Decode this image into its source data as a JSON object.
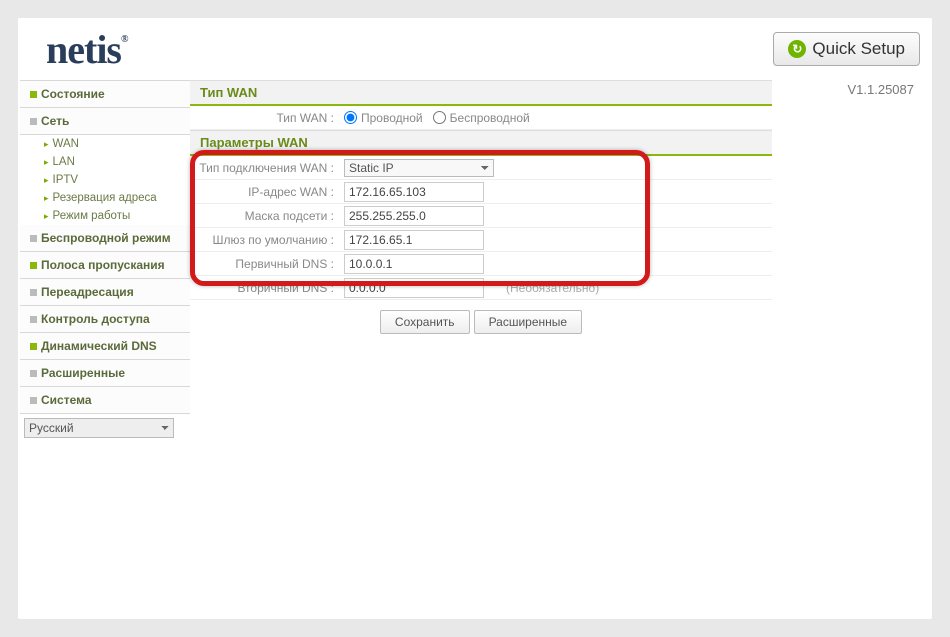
{
  "brand": "netis",
  "quick_setup": "Quick Setup",
  "version": "V1.1.25087",
  "language": {
    "selected": "Русский"
  },
  "sidebar": {
    "items": [
      {
        "label": "Состояние",
        "color": "green"
      },
      {
        "label": "Сеть",
        "color": "gray",
        "sub": [
          {
            "label": "WAN"
          },
          {
            "label": "LAN"
          },
          {
            "label": "IPTV"
          },
          {
            "label": "Резервация адреса"
          },
          {
            "label": "Режим работы"
          }
        ]
      },
      {
        "label": "Беспроводной режим",
        "color": "gray"
      },
      {
        "label": "Полоса пропускания",
        "color": "green"
      },
      {
        "label": "Переадресация",
        "color": "gray"
      },
      {
        "label": "Контроль доступа",
        "color": "gray"
      },
      {
        "label": "Динамический DNS",
        "color": "green"
      },
      {
        "label": "Расширенные",
        "color": "gray"
      },
      {
        "label": "Система",
        "color": "gray"
      }
    ]
  },
  "wan_type": {
    "header": "Тип WAN",
    "label": "Тип WAN :",
    "options": {
      "wired": "Проводной",
      "wireless": "Беспроводной"
    },
    "selected": "wired"
  },
  "wan_params": {
    "header": "Параметры WAN",
    "conn_label": "Тип подключения WAN :",
    "conn_value": "Static IP",
    "fields": {
      "ip": {
        "label": "IP-адрес WAN :",
        "value": "172.16.65.103"
      },
      "mask": {
        "label": "Маска подсети :",
        "value": "255.255.255.0"
      },
      "gw": {
        "label": "Шлюз по умолчанию :",
        "value": "172.16.65.1"
      },
      "dns1": {
        "label": "Первичный DNS :",
        "value": "10.0.0.1"
      },
      "dns2": {
        "label": "Вторичный DNS :",
        "value": "0.0.0.0",
        "note": "(Необязательно)"
      }
    }
  },
  "buttons": {
    "save": "Сохранить",
    "advanced": "Расширенные"
  }
}
